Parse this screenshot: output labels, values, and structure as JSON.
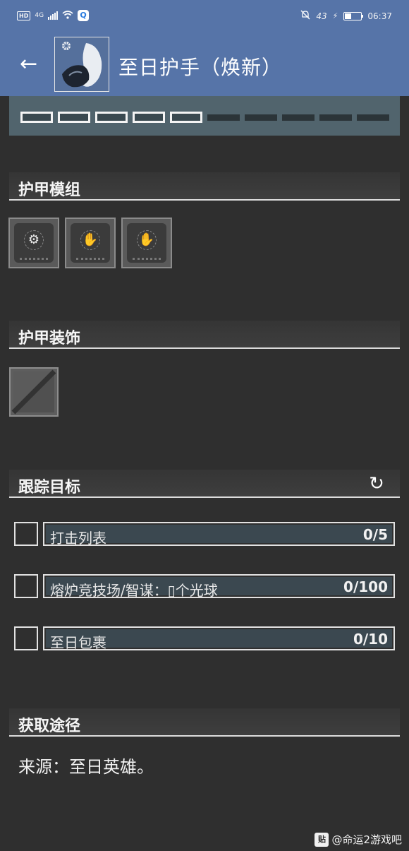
{
  "status_bar": {
    "hd": "HD",
    "network": "4G",
    "battery_text": "43",
    "battery_level": 0.43,
    "time": "06:37",
    "app_badge": "Q"
  },
  "header": {
    "back_glyph": "←",
    "title": "至日护手（焕新）",
    "thumb_icon": "gauntlet-icon"
  },
  "tiers": {
    "total": 10,
    "completed": 5
  },
  "sections": {
    "mods": "护甲模组",
    "ornament": "护甲装饰",
    "objectives": "跟踪目标",
    "source": "获取途径"
  },
  "mods": [
    {
      "icon": "gear-mod-icon",
      "glyph": "⚙"
    },
    {
      "icon": "hand-mod-icon",
      "glyph": "✋"
    },
    {
      "icon": "hand-mod-icon",
      "glyph": "✋"
    }
  ],
  "objectives": [
    {
      "name": "打击列表",
      "progress": "0/5",
      "fraction": 0
    },
    {
      "name": "熔炉竞技场/智谋：▯个光球",
      "progress": "0/100",
      "fraction": 0
    },
    {
      "name": "至日包裹",
      "progress": "0/10",
      "fraction": 0
    }
  ],
  "refresh_glyph": "↻",
  "source_text": "来源：至日英雄。",
  "watermark": {
    "badge": "贴",
    "text": "@命运2游戏吧"
  }
}
